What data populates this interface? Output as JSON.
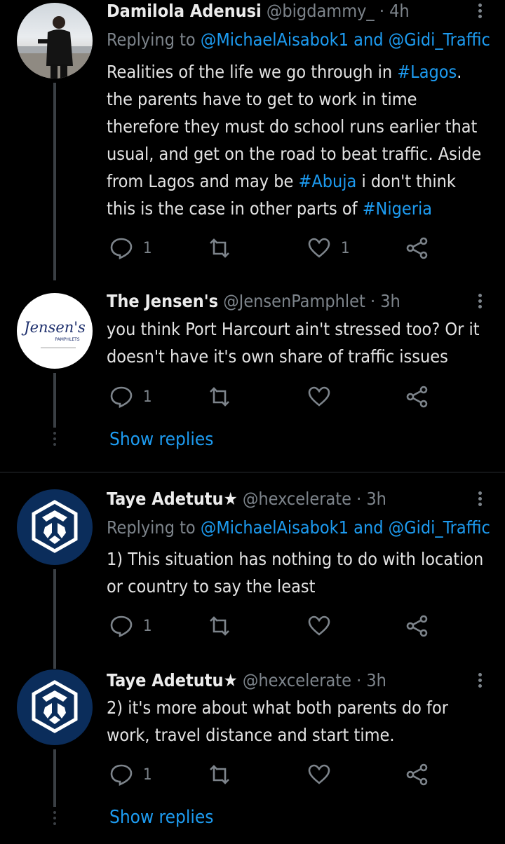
{
  "tweets": [
    {
      "name": "Damilola Adenusi",
      "handle": "@bigdammy_",
      "time": "· 4h",
      "replying_prefix": "Replying to",
      "replying_users": [
        "@MichaelAisabok1",
        "@Gidi_Traffic"
      ],
      "replying_and": "and",
      "body_parts": [
        {
          "t": "Realities of the life we go through in ",
          "link": false
        },
        {
          "t": "#Lagos",
          "link": true
        },
        {
          "t": ". the parents have to get to work in time therefore they must do school runs earlier that usual, and get on the road to beat traffic. Aside from Lagos and may be ",
          "link": false
        },
        {
          "t": "#Abuja",
          "link": true
        },
        {
          "t": " i don't think this is the case in other parts of ",
          "link": false
        },
        {
          "t": "#Nigeria",
          "link": true
        }
      ],
      "reply_count": "1",
      "like_count": "1"
    },
    {
      "name": "The Jensen's",
      "handle": "@JensenPamphlet",
      "time": "· 3h",
      "avatar_text": "Jensen's",
      "avatar_subtext": "PAMPHLETS",
      "body": "you think Port Harcourt ain't stressed too? Or it doesn't have it's own share of traffic issues",
      "reply_count": "1",
      "like_count": ""
    },
    {
      "name": "Taye Adetutu★",
      "handle": "@hexcelerate",
      "time": "· 3h",
      "replying_prefix": "Replying to",
      "replying_users": [
        "@MichaelAisabok1",
        "@Gidi_Traffic"
      ],
      "replying_and": "and",
      "body": "1) This situation has nothing to do with location or country to say the least",
      "reply_count": "1",
      "like_count": ""
    },
    {
      "name": "Taye Adetutu★",
      "handle": "@hexcelerate",
      "time": "· 3h",
      "body": "2) it's more about what both parents do for work, travel distance and start time.",
      "reply_count": "1",
      "like_count": ""
    }
  ],
  "show_replies_label": "Show replies",
  "colors": {
    "link": "#1d9bf0",
    "muted": "#7d848b",
    "crypto_bg": "#0b2d5b"
  }
}
